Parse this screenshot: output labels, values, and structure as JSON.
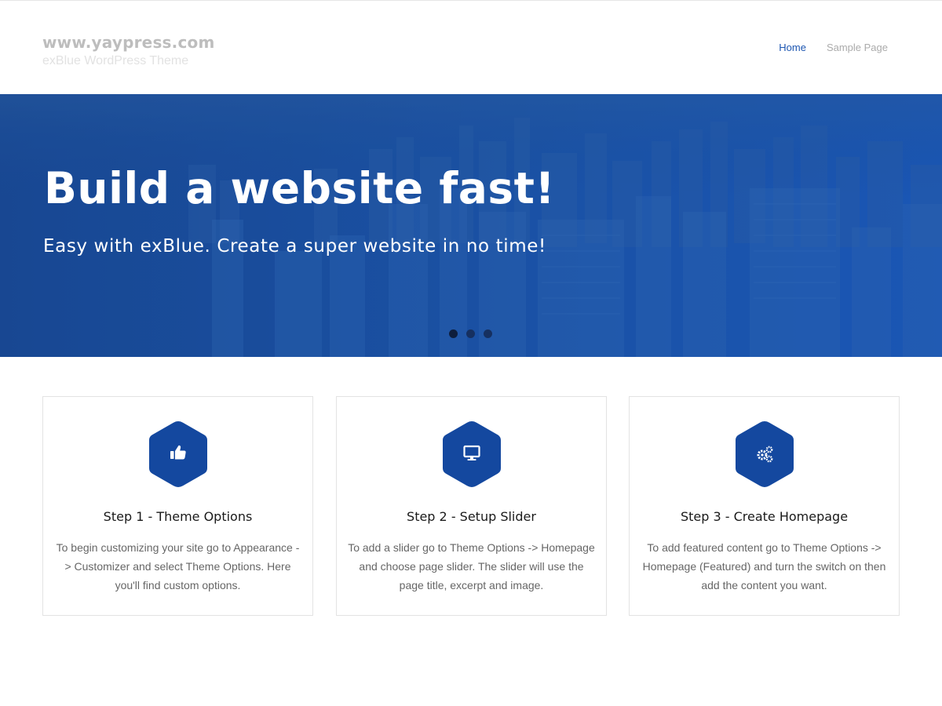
{
  "header": {
    "site_title": "www.yaypress.com",
    "site_description": "exBlue WordPress Theme",
    "nav": [
      {
        "label": "Home",
        "active": true
      },
      {
        "label": "Sample Page",
        "active": false
      }
    ]
  },
  "hero": {
    "title": "Build a website fast!",
    "subtitle": "Easy with exBlue. Create a super website in no time!",
    "slides_total": 3,
    "active_slide": 1
  },
  "features": [
    {
      "icon": "thumbs-up-icon",
      "title": "Step 1 - Theme Options",
      "text": "To begin customizing your site go to Appearance -> Customizer and select Theme Options. Here you'll find custom options."
    },
    {
      "icon": "desktop-icon",
      "title": "Step 2 - Setup Slider",
      "text": "To add a slider go to Theme Options -> Homepage and choose page slider. The slider will use the page title, excerpt and image."
    },
    {
      "icon": "gears-icon",
      "title": "Step 3 - Create Homepage",
      "text": "To add featured content go to Theme Options -> Homepage (Featured) and turn the switch on then add the content you want."
    }
  ],
  "colors": {
    "accent": "#1d56b1",
    "hex_icon": "#14489f",
    "hero_overlay": "#1a52a6"
  }
}
